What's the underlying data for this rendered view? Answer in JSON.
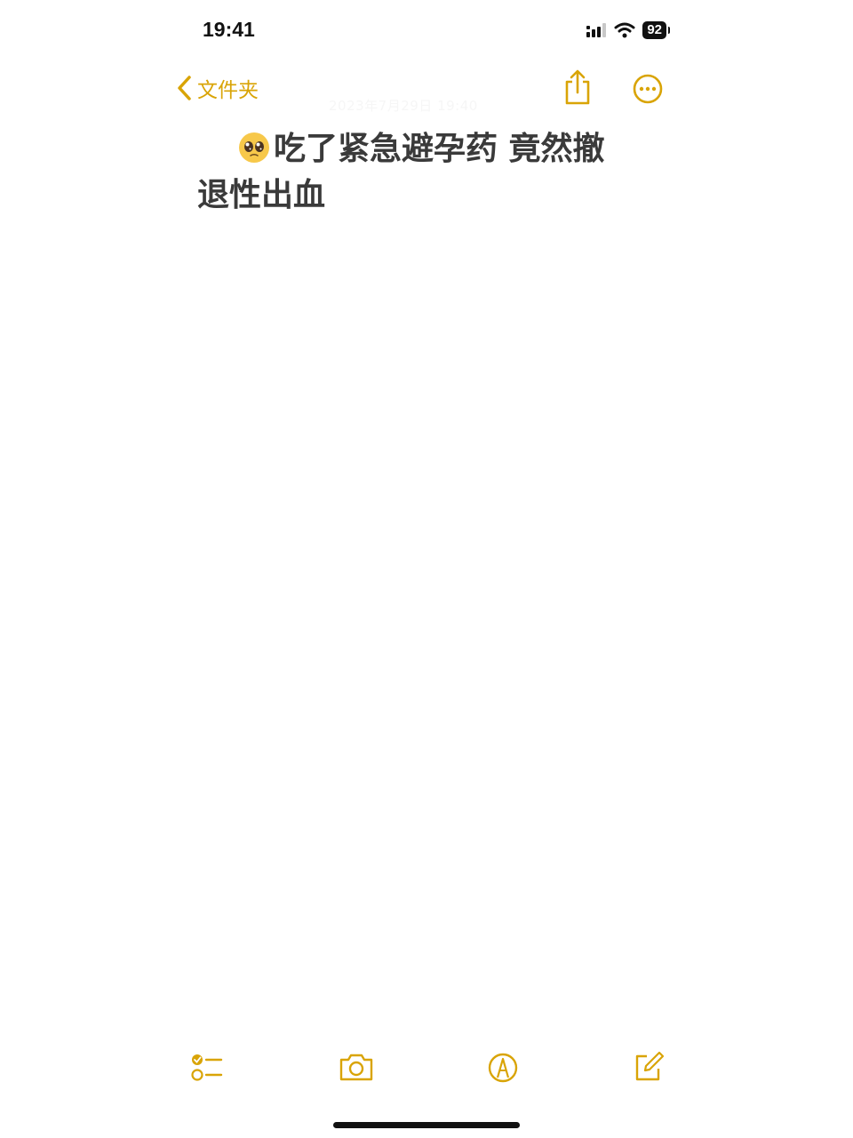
{
  "status_bar": {
    "time": "19:41",
    "battery": "92"
  },
  "nav": {
    "back_label": "文件夹",
    "date": "2023年7月29日 19:40"
  },
  "note": {
    "title_line1": "吃了紧急避孕药 竟然撤",
    "title_line2": "退性出血"
  },
  "colors": {
    "accent": "#d9a406",
    "title": "#3a3a3a"
  },
  "icons": {
    "back": "chevron-left-icon",
    "share": "share-icon",
    "more": "ellipsis-circle-icon",
    "checklist": "checklist-icon",
    "camera": "camera-icon",
    "markup": "markup-pen-icon",
    "compose": "compose-icon"
  }
}
